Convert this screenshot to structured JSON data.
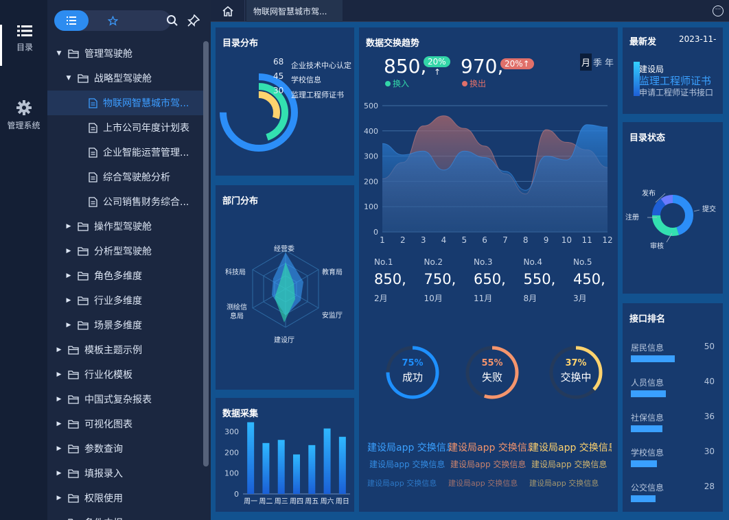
{
  "rail": {
    "items": [
      {
        "label": "目录",
        "icon": "list-icon"
      },
      {
        "label": "管理系统",
        "icon": "gear-icon"
      }
    ]
  },
  "tree": {
    "nodes": [
      {
        "label": "管理驾驶舱",
        "level": 0,
        "type": "folder",
        "expanded": true
      },
      {
        "label": "战略型驾驶舱",
        "level": 1,
        "type": "folder",
        "expanded": true
      },
      {
        "label": "物联网智慧城市驾...",
        "level": 2,
        "type": "file",
        "selected": true
      },
      {
        "label": "上市公司年度计划表",
        "level": 2,
        "type": "file"
      },
      {
        "label": "企业智能运营管理...",
        "level": 2,
        "type": "file"
      },
      {
        "label": "综合驾驶舱分析",
        "level": 2,
        "type": "file"
      },
      {
        "label": "公司销售财务综合...",
        "level": 2,
        "type": "file"
      },
      {
        "label": "操作型驾驶舱",
        "level": 1,
        "type": "folder"
      },
      {
        "label": "分析型驾驶舱",
        "level": 1,
        "type": "folder"
      },
      {
        "label": "角色多维度",
        "level": 1,
        "type": "folder"
      },
      {
        "label": "行业多维度",
        "level": 1,
        "type": "folder"
      },
      {
        "label": "场景多维度",
        "level": 1,
        "type": "folder"
      },
      {
        "label": "模板主题示例",
        "level": 0,
        "type": "folder"
      },
      {
        "label": "行业化模板",
        "level": 0,
        "type": "folder"
      },
      {
        "label": "中国式复杂报表",
        "level": 0,
        "type": "folder"
      },
      {
        "label": "可视化图表",
        "level": 0,
        "type": "folder"
      },
      {
        "label": "参数查询",
        "level": 0,
        "type": "folder"
      },
      {
        "label": "填报录入",
        "level": 0,
        "type": "folder"
      },
      {
        "label": "权限使用",
        "level": 0,
        "type": "folder"
      },
      {
        "label": "条件内报",
        "level": 0,
        "type": "folder"
      }
    ]
  },
  "tabs": {
    "active": "物联网智慧城市驾..."
  },
  "panels": {
    "catalog": {
      "title": "目录分布",
      "rings": [
        {
          "value": 68,
          "label": "企业技术中心认定",
          "color": "#2c8ef8"
        },
        {
          "value": 45,
          "label": "学校信息",
          "color": "#33e0b0"
        },
        {
          "value": 30,
          "label": "监理工程师证书",
          "color": "#ffd36e"
        }
      ]
    },
    "dept": {
      "title": "部门分布",
      "axes": [
        "经营委",
        "教育局",
        "安监厅",
        "建设厅",
        "测绘信息局",
        "科技局"
      ]
    },
    "collect": {
      "title": "数据采集"
    },
    "trend": {
      "title": "数据交换趋势",
      "in_value": "850,",
      "in_pct": "20%",
      "in_label": "换入",
      "out_value": "970,",
      "out_pct": "20%",
      "out_label": "换出",
      "toggle": [
        "月",
        "季",
        "年"
      ]
    },
    "ranks": [
      {
        "no": "No.1",
        "value": "850,",
        "month": "2月"
      },
      {
        "no": "No.2",
        "value": "750,",
        "month": "10月"
      },
      {
        "no": "No.3",
        "value": "650,",
        "month": "11月"
      },
      {
        "no": "No.4",
        "value": "550,",
        "month": "8月"
      },
      {
        "no": "No.5",
        "value": "450,",
        "month": "3月"
      }
    ],
    "gauges": [
      {
        "pct": "75%",
        "label": "成功",
        "value": 0.75,
        "color": "#1e90ff"
      },
      {
        "pct": "55%",
        "label": "失败",
        "value": 0.55,
        "color": "#f5956d"
      },
      {
        "pct": "37%",
        "label": "交换中",
        "value": 0.37,
        "color": "#ffd36e"
      }
    ],
    "scroll_text": [
      {
        "text": "建设局app 交换信息",
        "color": "#3aa0ff"
      },
      {
        "text": "建设局app 交换信息",
        "color": "#f5956d"
      },
      {
        "text": "建设局app 交换信息",
        "color": "#ffd36e"
      }
    ],
    "latest": {
      "title": "最新发",
      "date": "2023-11-",
      "org": "建设局",
      "item": "监理工程师证书",
      "desc": "申请工程师证书接口"
    },
    "status": {
      "title": "目录状态",
      "labels": [
        "发布",
        "提交",
        "注册",
        "审核"
      ]
    },
    "interface": {
      "title": "接口排名"
    }
  },
  "chart_data": [
    {
      "type": "area",
      "title": "数据交换趋势",
      "x": [
        1,
        2,
        3,
        4,
        5,
        6,
        7,
        8,
        9,
        10,
        11,
        12
      ],
      "series": [
        {
          "name": "换入",
          "values": [
            350,
            305,
            320,
            245,
            320,
            295,
            240,
            165,
            300,
            285,
            425,
            415
          ]
        },
        {
          "name": "换出",
          "values": [
            210,
            275,
            420,
            460,
            410,
            340,
            230,
            150,
            405,
            355,
            325,
            255
          ]
        }
      ],
      "ylim": [
        0,
        500
      ],
      "yticks": [
        0,
        100,
        200,
        300,
        400,
        500
      ],
      "grid": true
    },
    {
      "type": "bar",
      "title": "数据采集",
      "categories": [
        "周一",
        "周二",
        "周三",
        "周四",
        "周五",
        "周六",
        "周日"
      ],
      "values": [
        345,
        245,
        260,
        190,
        235,
        315,
        275
      ],
      "ylim": [
        0,
        350
      ],
      "yticks": [
        0,
        100,
        200,
        300
      ]
    },
    {
      "type": "bar",
      "title": "接口排名",
      "categories": [
        "居民信息",
        "人员信息",
        "社保信息",
        "学校信息",
        "公交信息"
      ],
      "values": [
        50,
        40,
        36,
        30,
        28
      ],
      "xlim": [
        0,
        50
      ]
    },
    {
      "type": "pie",
      "title": "目录状态",
      "categories": [
        "提交",
        "审核",
        "注册",
        "发布"
      ],
      "values": [
        45,
        30,
        15,
        10
      ]
    }
  ]
}
